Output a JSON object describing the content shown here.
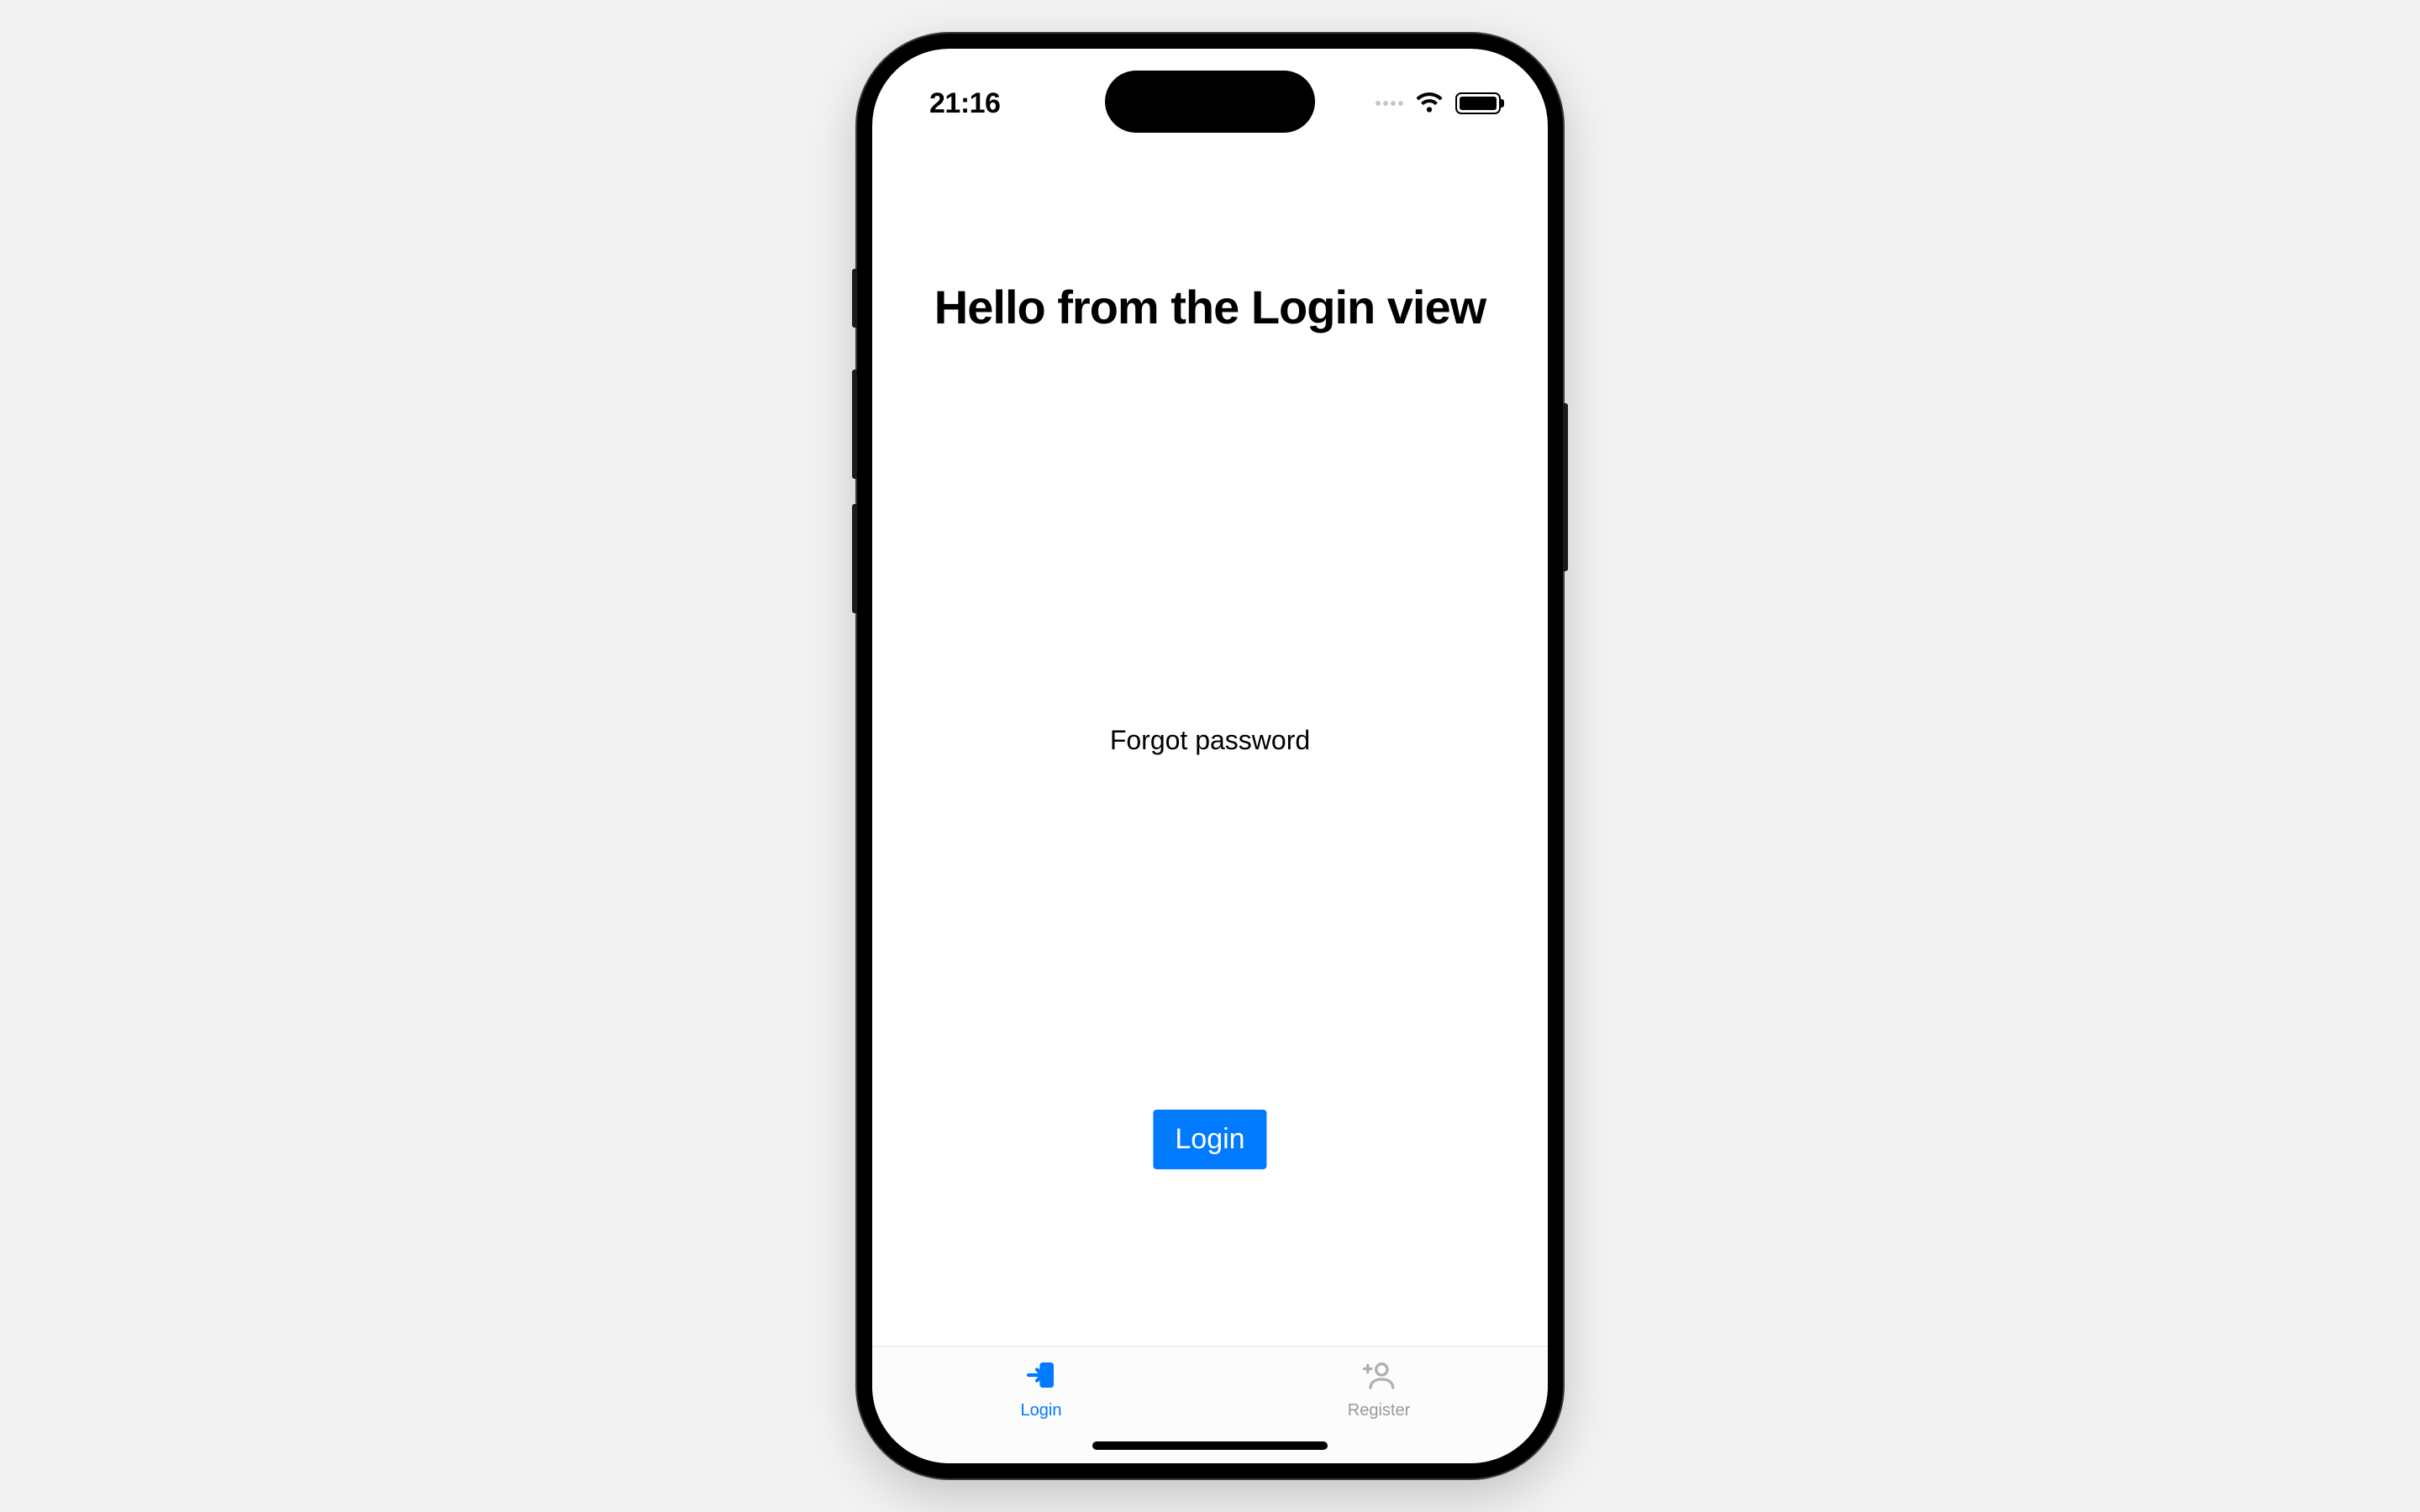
{
  "status_bar": {
    "time": "21:16"
  },
  "main": {
    "heading": "Hello from the Login view",
    "forgot_password_label": "Forgot password",
    "login_button_label": "Login"
  },
  "tab_bar": {
    "items": [
      {
        "label": "Login",
        "icon": "log-in-icon",
        "active": true
      },
      {
        "label": "Register",
        "icon": "person-add-icon",
        "active": false
      }
    ]
  },
  "colors": {
    "accent": "#007aff",
    "inactive": "#9a9a9a"
  }
}
